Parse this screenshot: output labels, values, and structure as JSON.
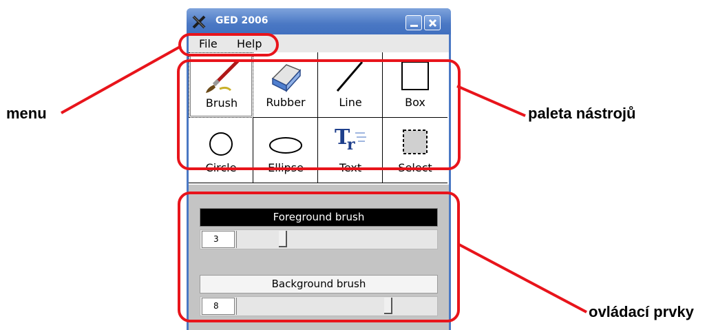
{
  "window": {
    "title": "GED 2006"
  },
  "menu": {
    "items": [
      "File",
      "Help"
    ]
  },
  "tools": [
    {
      "label": "Brush",
      "icon": "brush-icon"
    },
    {
      "label": "Rubber",
      "icon": "rubber-icon"
    },
    {
      "label": "Line",
      "icon": "line-icon"
    },
    {
      "label": "Box",
      "icon": "box-icon"
    },
    {
      "label": "Circle",
      "icon": "circle-icon"
    },
    {
      "label": "Ellipse",
      "icon": "ellipse-icon"
    },
    {
      "label": "Text",
      "icon": "text-icon"
    },
    {
      "label": "Select",
      "icon": "select-icon"
    }
  ],
  "controls": {
    "foreground": {
      "label": "Foreground brush",
      "value": "3",
      "level": 0.22
    },
    "background": {
      "label": "Background brush",
      "value": "8",
      "level": 0.77
    }
  },
  "annotations": {
    "menu": "menu",
    "palette": "paleta nástrojů",
    "controls": "ovládací prvky"
  },
  "colors": {
    "callout": "#e8141b",
    "titlebar": "#4a78c4"
  }
}
